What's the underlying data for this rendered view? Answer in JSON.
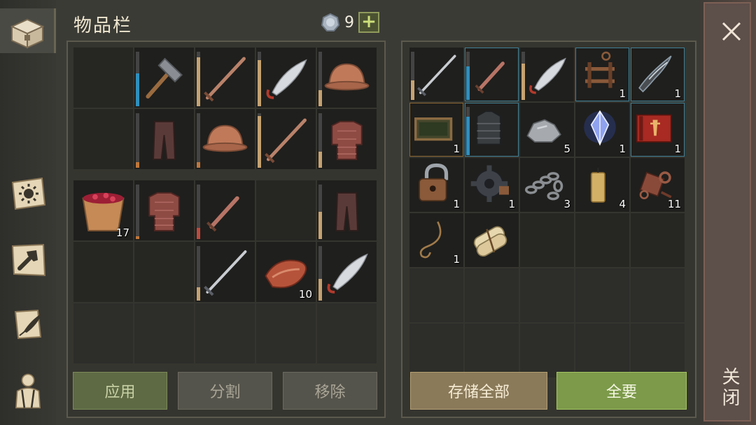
{
  "header": {
    "title": "物品栏",
    "coins": "9",
    "plus": "+"
  },
  "sidebar": {
    "items": [
      {
        "name": "inventory",
        "icon": "chest-icon",
        "active": true
      },
      {
        "name": "skills",
        "icon": "sun-book-icon",
        "active": false
      },
      {
        "name": "crafting",
        "icon": "hammer-icon",
        "active": false
      },
      {
        "name": "quests",
        "icon": "scroll-quill-icon",
        "active": false
      },
      {
        "name": "character",
        "icon": "character-icon",
        "active": false
      }
    ]
  },
  "inventory": {
    "slots": [
      {
        "icon": "",
        "qty": ""
      },
      {
        "icon": "sledgehammer-icon",
        "qty": "",
        "bar": "blue",
        "level": 0.6
      },
      {
        "icon": "sword-icon",
        "qty": "",
        "bar": "tan",
        "level": 0.9
      },
      {
        "icon": "scimitar-icon",
        "qty": "",
        "bar": "tan",
        "level": 0.85
      },
      {
        "icon": "helmet-icon",
        "qty": "",
        "bar": "tan",
        "level": 0.3
      },
      {
        "icon": "",
        "qty": ""
      },
      {
        "icon": "leather-pants-icon",
        "qty": "",
        "bar": "orange",
        "level": 0.1
      },
      {
        "icon": "helmet-icon",
        "qty": "",
        "bar": "orange",
        "level": 0.1
      },
      {
        "icon": "sword-icon",
        "qty": "",
        "bar": "tan",
        "level": 0.95
      },
      {
        "icon": "chainmail-icon",
        "qty": "",
        "bar": "tan",
        "level": 0.3
      },
      {
        "icon": "berry-bucket-icon",
        "qty": "17"
      },
      {
        "icon": "chainmail-icon",
        "qty": "",
        "bar": "orange",
        "level": 0.05
      },
      {
        "icon": "short-sword-icon",
        "qty": "",
        "bar": "red",
        "level": 0.2
      },
      {
        "icon": "",
        "qty": ""
      },
      {
        "icon": "leather-pants-icon",
        "qty": "",
        "bar": "tan",
        "level": 0.5
      },
      {
        "icon": "",
        "qty": ""
      },
      {
        "icon": "",
        "qty": ""
      },
      {
        "icon": "longsword-icon",
        "qty": "",
        "bar": "tan",
        "level": 0.25
      },
      {
        "icon": "raw-meat-icon",
        "qty": "10"
      },
      {
        "icon": "scimitar-icon",
        "qty": "",
        "bar": "tan",
        "level": 0.4
      }
    ],
    "empty_rows": 1
  },
  "storage": {
    "slots": [
      {
        "icon": "longsword-icon",
        "qty": "",
        "bar": "tan",
        "level": 0.4
      },
      {
        "icon": "short-sword-icon",
        "qty": "",
        "bar": "blue",
        "level": 0.7,
        "frame": "blue"
      },
      {
        "icon": "scimitar-icon",
        "qty": "",
        "bar": "tan",
        "level": 0.75
      },
      {
        "icon": "rack-icon",
        "qty": "1",
        "frame": "blue"
      },
      {
        "icon": "bone-blade-icon",
        "qty": "1",
        "frame": "blue"
      },
      {
        "icon": "window-frame-icon",
        "qty": "1",
        "frame": "orange"
      },
      {
        "icon": "armor-vest-icon",
        "qty": "",
        "frame": "blue",
        "bar": "blue",
        "level": 0.8
      },
      {
        "icon": "stone-icon",
        "qty": "5"
      },
      {
        "icon": "crystal-icon",
        "qty": "1"
      },
      {
        "icon": "red-book-icon",
        "qty": "1",
        "frame": "blue"
      },
      {
        "icon": "padlock-icon",
        "qty": "1"
      },
      {
        "icon": "gear-icon",
        "qty": "1"
      },
      {
        "icon": "chain-icon",
        "qty": "3"
      },
      {
        "icon": "candle-icon",
        "qty": "4"
      },
      {
        "icon": "scrap-parts-icon",
        "qty": "11"
      },
      {
        "icon": "rope-icon",
        "qty": "1"
      },
      {
        "icon": "scroll-bundle-icon",
        "qty": ""
      },
      {
        "icon": "",
        "qty": ""
      },
      {
        "icon": "",
        "qty": ""
      },
      {
        "icon": "",
        "qty": ""
      }
    ],
    "empty_rows": 2
  },
  "buttons": {
    "apply": "应用",
    "split": "分割",
    "remove": "移除",
    "store_all": "存储全部",
    "take_all": "全要"
  },
  "close": {
    "label": "关闭"
  },
  "colors": {
    "bar_blue": "#2f8fbd",
    "bar_tan": "#c5a271",
    "bar_orange": "#c0773b",
    "bar_red": "#c04a3c",
    "apply": "#5e6a44",
    "take_all": "#7c9a4a",
    "store_all": "#8a7a5a"
  }
}
